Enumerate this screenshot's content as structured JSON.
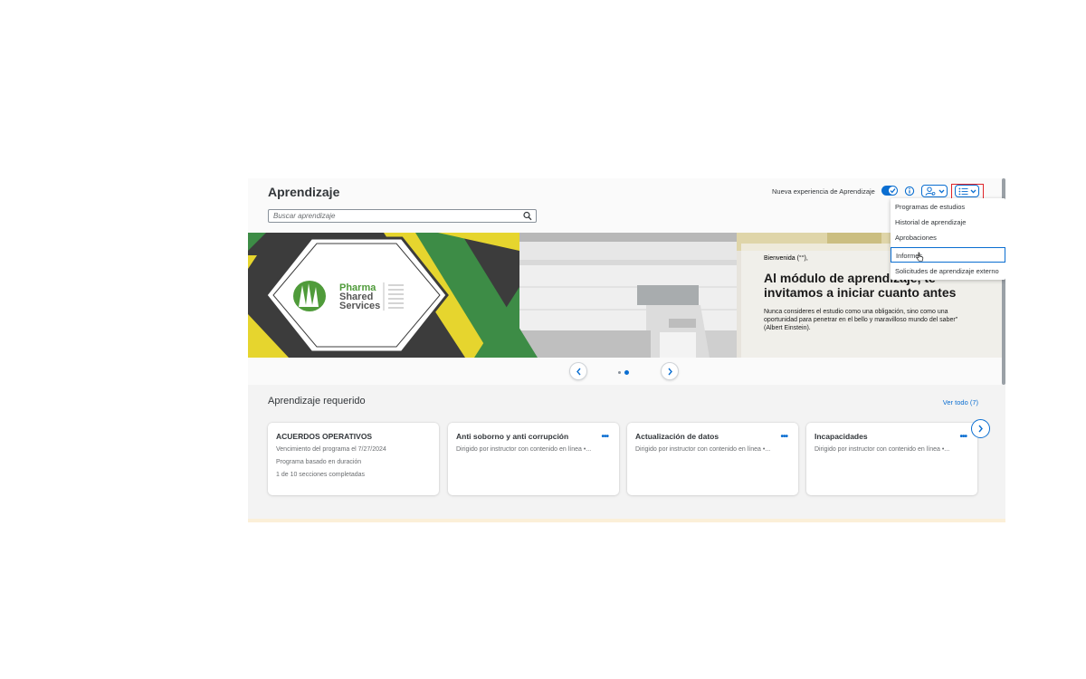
{
  "header": {
    "title": "Aprendizaje",
    "search_placeholder": "Buscar aprendizaje",
    "new_experience_label": "Nueva experiencia de Aprendizaje"
  },
  "menu": {
    "items": [
      "Programas de estudios",
      "Historial de aprendizaje",
      "Aprobaciones",
      "Informes",
      "Solicitudes de aprendizaje externo"
    ],
    "active_index": 3
  },
  "hero": {
    "greeting": "Bienvenida (°°),",
    "headline": "Al módulo de aprendizaje, te invitamos a iniciar cuanto antes",
    "quote": "Nunca consideres el estudio como una obligación, sino como una oportunidad para penetrar en el bello y maravilloso mundo del saber\" (Albert Einstein).",
    "logo": {
      "line1": "Pharma",
      "line2": "Shared",
      "line3": "Services"
    }
  },
  "carousel": {
    "slide_count": 2,
    "current_slide": 2
  },
  "required": {
    "title": "Aprendizaje requerido",
    "see_all": "Ver todo (7)",
    "cards": [
      {
        "title": "ACUERDOS OPERATIVOS",
        "line1": "Vencimiento del programa el 7/27/2024",
        "line2": "Programa basado en duración",
        "line3": "1 de 10 secciones completadas",
        "more": ""
      },
      {
        "title": "Anti soborno y anti corrupción",
        "line1": "Dirigido por instructor con contenido en línea •...",
        "line2": "",
        "line3": "",
        "more": "•••"
      },
      {
        "title": "Actualización de datos",
        "line1": "Dirigido por instructor con contenido en línea •...",
        "line2": "",
        "line3": "",
        "more": "•••"
      },
      {
        "title": "Incapacidades",
        "line1": "Dirigido por instructor con contenido en línea •...",
        "line2": "",
        "line3": "",
        "more": "•••"
      }
    ]
  },
  "colors": {
    "accent": "#0a6ed1",
    "highlight": "#e0262b",
    "logo_green": "#3d8c46",
    "logo_yellow": "#e6d52e"
  },
  "icons": [
    "search-icon",
    "check-icon",
    "info-icon",
    "user-settings-icon",
    "list-icon",
    "chevron-down-icon",
    "chevron-left-icon",
    "chevron-right-icon",
    "more-icon",
    "pointer-cursor-icon"
  ]
}
